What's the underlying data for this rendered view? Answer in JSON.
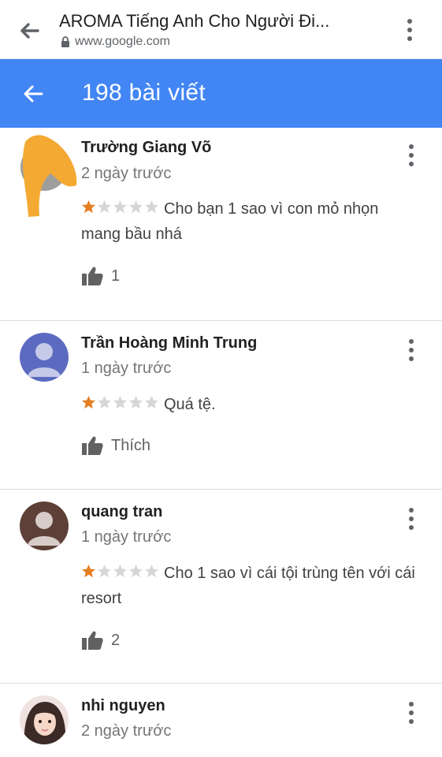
{
  "browser": {
    "title": "AROMA Tiếng Anh Cho Người Đi...",
    "url": "www.google.com",
    "back_icon": "arrow-back-icon",
    "menu_icon": "more-vert-icon"
  },
  "header": {
    "title": "198 bài viết",
    "background": "#4285f4",
    "back_icon": "arrow-back-icon"
  },
  "star_colors": {
    "filled": "#e67e22",
    "empty": "#d6d6d6"
  },
  "reviews": [
    {
      "name": "Trường Giang Võ",
      "date": "2 ngày trước",
      "rating": 1,
      "text": "Cho bạn 1 sao vì con mỏ nhọn mang bầu nhá",
      "like_label": "1",
      "avatar": "obscured-avatar"
    },
    {
      "name": "Trần Hoàng Minh Trung",
      "date": "1 ngày trước",
      "rating": 1,
      "text": "Quá tệ.",
      "like_label": "Thích",
      "avatar": "default-person-avatar"
    },
    {
      "name": "quang tran",
      "date": "1 ngày trước",
      "rating": 1,
      "text": "Cho 1 sao vì cái tội trùng tên với cái resort",
      "like_label": "2",
      "avatar": "default-person-avatar"
    },
    {
      "name": "nhi nguyen",
      "date": "2 ngày trước",
      "rating": null,
      "text": "",
      "like_label": "",
      "avatar": "photo-avatar"
    }
  ]
}
